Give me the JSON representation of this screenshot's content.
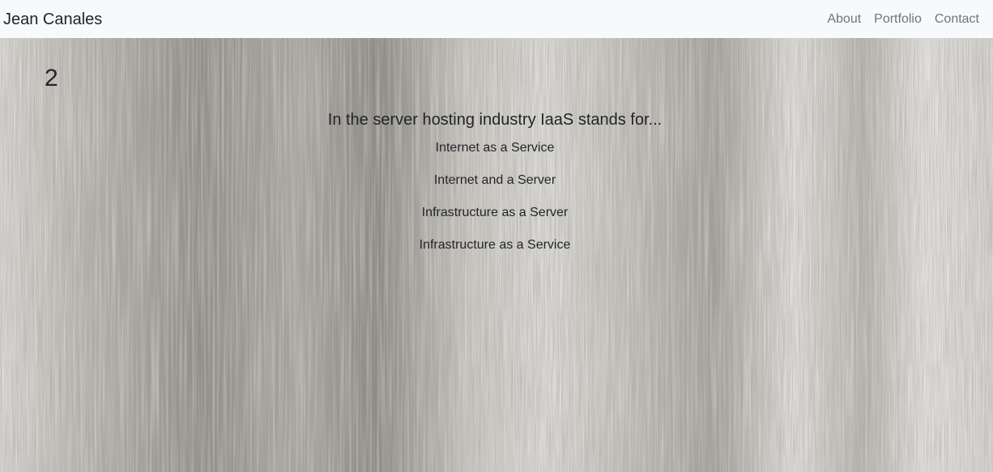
{
  "navbar": {
    "brand": "Jean Canales",
    "links": [
      "About",
      "Portfolio",
      "Contact"
    ]
  },
  "quiz": {
    "question_number": "2",
    "question": "In the server hosting industry IaaS stands for...",
    "answers": [
      "Internet as a Service",
      "Internet and a Server",
      "Infrastructure as a Server",
      "Infrastructure as a Service"
    ]
  },
  "background": {
    "texture": "weathered-wood-texture",
    "base_color": "#cfccc6",
    "dark_color": "#6f6c67",
    "light_color": "#ecebe8"
  }
}
